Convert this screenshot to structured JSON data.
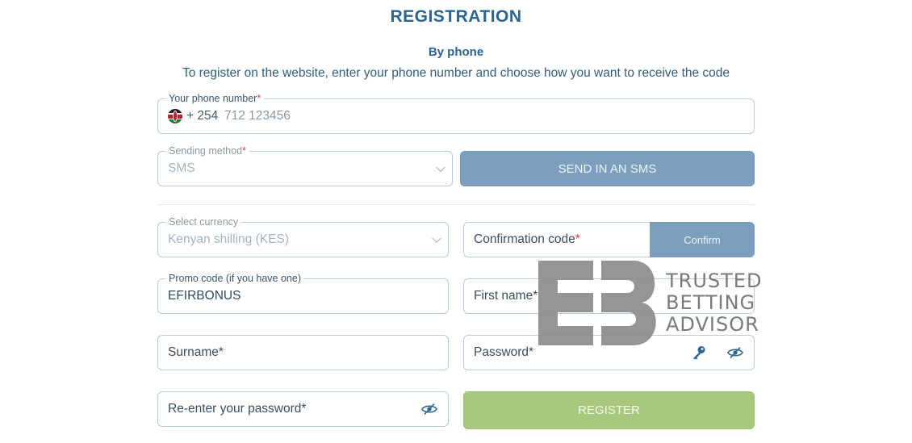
{
  "page": {
    "title": "REGISTRATION",
    "method": "By phone",
    "description": "To register on the website, enter your phone number and choose how you want to receive the code"
  },
  "phone": {
    "label": "Your phone number",
    "required_mark": "*",
    "country_icon": "kenya-flag-icon",
    "prefix": "+ 254",
    "placeholder": "712 123456"
  },
  "sending_method": {
    "label": "Sending method",
    "required_mark": "*",
    "value": "SMS"
  },
  "send_button": {
    "label": "SEND IN AN SMS"
  },
  "currency": {
    "label": "Select currency",
    "value": "Kenyan shilling (KES)"
  },
  "confirmation": {
    "placeholder": "Confirmation code",
    "required_mark": "*",
    "button_label": "Confirm"
  },
  "promo": {
    "label": "Promo code (if you have one)",
    "value": "EFIRBONUS"
  },
  "first_name": {
    "placeholder": "First name*"
  },
  "surname": {
    "placeholder": "Surname*"
  },
  "password": {
    "placeholder": "Password*",
    "key_icon": "key-icon",
    "eye_icon": "eye-slash-icon"
  },
  "reenter_password": {
    "placeholder": "Re-enter your password*",
    "eye_icon": "eye-slash-icon"
  },
  "register_button": {
    "label": "REGISTER"
  },
  "watermark": {
    "line1": "TRUSTED",
    "line2": "BETTING",
    "line3": "ADVISOR"
  },
  "colors": {
    "accent": "#2b6391",
    "button_blue": "#7c9fbd",
    "button_green": "#a8c87d",
    "required": "#e03c4c",
    "border": "#b9ccd9"
  }
}
